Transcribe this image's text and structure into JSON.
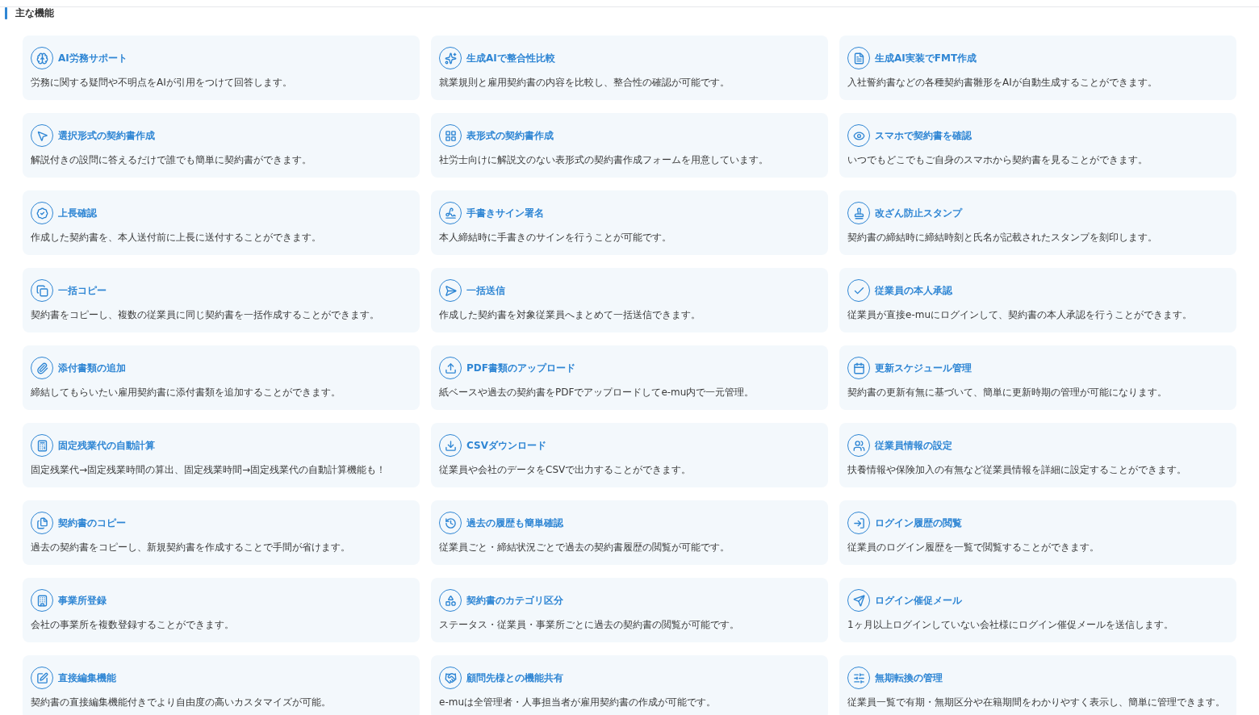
{
  "section": {
    "title": "主な機能"
  },
  "features": [
    {
      "title": "AI労務サポート",
      "description": "労務に関する疑問や不明点をAIが引用をつけて回答します。"
    },
    {
      "title": "生成AIで整合性比較",
      "description": "就業規則と雇用契約書の内容を比較し、整合性の確認が可能です。"
    },
    {
      "title": "生成AI実装でFMT作成",
      "description": "入社誓約書などの各種契約書雛形をAIが自動生成することができます。"
    },
    {
      "title": "選択形式の契約書作成",
      "description": "解説付きの設問に答えるだけで誰でも簡単に契約書ができます。"
    },
    {
      "title": "表形式の契約書作成",
      "description": "社労士向けに解説文のない表形式の契約書作成フォームを用意しています。"
    },
    {
      "title": "スマホで契約書を確認",
      "description": "いつでもどこでもご自身のスマホから契約書を見ることができます。"
    },
    {
      "title": "上長確認",
      "description": "作成した契約書を、本人送付前に上長に送付することができます。"
    },
    {
      "title": "手書きサイン署名",
      "description": "本人締結時に手書きのサインを行うことが可能です。"
    },
    {
      "title": "改ざん防止スタンプ",
      "description": "契約書の締結時に締結時刻と氏名が記載されたスタンプを刻印します。"
    },
    {
      "title": "一括コピー",
      "description": "契約書をコピーし、複数の従業員に同じ契約書を一括作成することができます。"
    },
    {
      "title": "一括送信",
      "description": "作成した契約書を対象従業員へまとめて一括送信できます。"
    },
    {
      "title": "従業員の本人承認",
      "description": "従業員が直接e-muにログインして、契約書の本人承認を行うことができます。"
    },
    {
      "title": "添付書類の追加",
      "description": "締結してもらいたい雇用契約書に添付書類を追加することができます。"
    },
    {
      "title": "PDF書類のアップロード",
      "description": "紙ベースや過去の契約書をPDFでアップロードしてe-mu内で一元管理。"
    },
    {
      "title": "更新スケジュール管理",
      "description": "契約書の更新有無に基づいて、簡単に更新時期の管理が可能になります。"
    },
    {
      "title": "固定残業代の自動計算",
      "description": "固定残業代→固定残業時間の算出、固定残業時間→固定残業代の自動計算機能も！"
    },
    {
      "title": "CSVダウンロード",
      "description": "従業員や会社のデータをCSVで出力することができます。"
    },
    {
      "title": "従業員情報の設定",
      "description": "扶養情報や保険加入の有無など従業員情報を詳細に設定することができます。"
    },
    {
      "title": "契約書のコピー",
      "description": "過去の契約書をコピーし、新規契約書を作成することで手間が省けます。"
    },
    {
      "title": "過去の履歴も簡単確認",
      "description": "従業員ごと・締結状況ごとで過去の契約書履歴の閲覧が可能です。"
    },
    {
      "title": "ログイン履歴の閲覧",
      "description": "従業員のログイン履歴を一覧で閲覧することができます。"
    },
    {
      "title": "事業所登録",
      "description": "会社の事業所を複数登録することができます。"
    },
    {
      "title": "契約書のカテゴリ区分",
      "description": "ステータス・従業員・事業所ごとに過去の契約書の閲覧が可能です。"
    },
    {
      "title": "ログイン催促メール",
      "description": "1ヶ月以上ログインしていない会社様にログイン催促メールを送信します。"
    },
    {
      "title": "直接編集機能",
      "description": "契約書の直接編集機能付きでより自由度の高いカスタマイズが可能。"
    },
    {
      "title": "顧問先様との機能共有",
      "description": "e-muは全管理者・人事担当者が雇用契約書の作成が可能です。"
    },
    {
      "title": "無期転換の管理",
      "description": "従業員一覧で有期・無期区分や在籍期間をわかりやすく表示し、簡単に管理できます。"
    }
  ]
}
